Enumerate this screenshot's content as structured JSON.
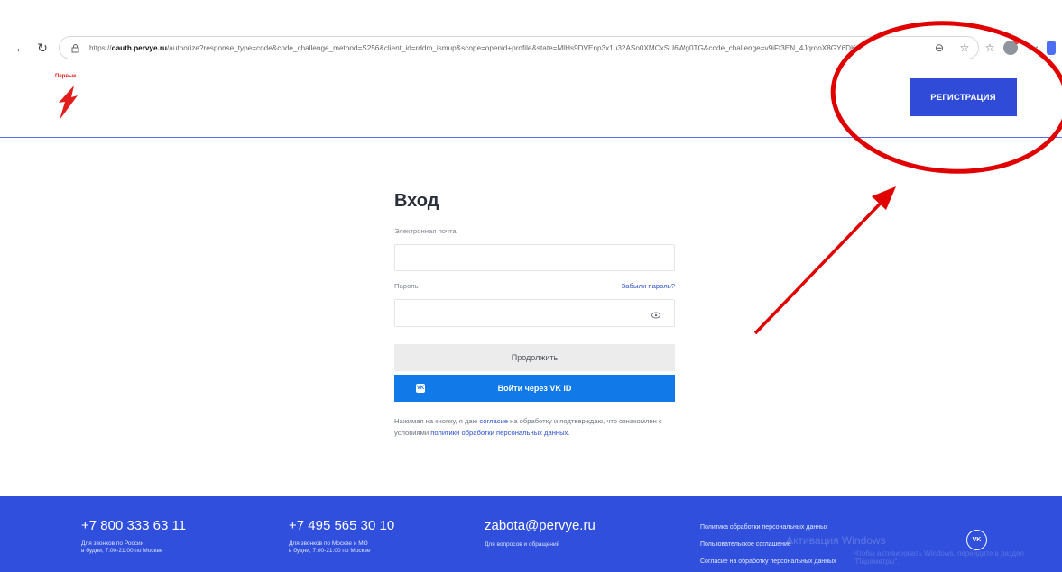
{
  "browser": {
    "url_prefix": "https://",
    "url_domain": "oauth.pervye.ru",
    "url_rest": "/authorize?response_type=code&code_challenge_method=S256&client_id=rddm_ismup&scope=openid+profile&state=MlHs9DVEnp3x1u32ASo0XMCxSU6Wg0TG&code_challenge=v9iFf3EN_4JqrdoX8GY6DKpmhgS..."
  },
  "header": {
    "brand": "Первые",
    "register_label": "РЕГИСТРАЦИЯ"
  },
  "login": {
    "title": "Вход",
    "email_label": "Электронная почта",
    "password_label": "Пароль",
    "forgot_label": "Забыли пароль?",
    "continue_label": "Продолжить",
    "vk_label": "Войти через VK ID",
    "consent_before": "Нажимая на кнопку, я даю ",
    "consent_link": "согласие",
    "consent_middle": " на обработку и подтверждаю, что ознакомлен с условиями ",
    "policy_link": "политики обработки персональных данных",
    "consent_end": "."
  },
  "footer": {
    "phone_ru": "+7 800 333 63 11",
    "phone_ru_note_1": "Для звонков по России",
    "phone_ru_note_2": "в будни, 7:00-21:00 по Москве",
    "phone_msk": "+7 495 565 30 10",
    "phone_msk_note_1": "Для звонков по Москве и МО",
    "phone_msk_note_2": "в будни, 7:00-21:00 по Москве",
    "email": "zabota@pervye.ru",
    "email_note": "Для вопросов и обращений",
    "policy_1": "Политика обработки персональных данных",
    "policy_2": "Пользовательское соглашение",
    "policy_3": "Согласие на обработку персональных данных",
    "watermark_1": "Активация Windows",
    "watermark_2": "Чтобы активировать Windows, перейдите в раздел \"Параметры\"."
  },
  "colors": {
    "brand_red": "#e21c1c",
    "primary_blue": "#2f4fdc",
    "vk_blue": "#1179e8",
    "annotation_red": "#e00000"
  }
}
